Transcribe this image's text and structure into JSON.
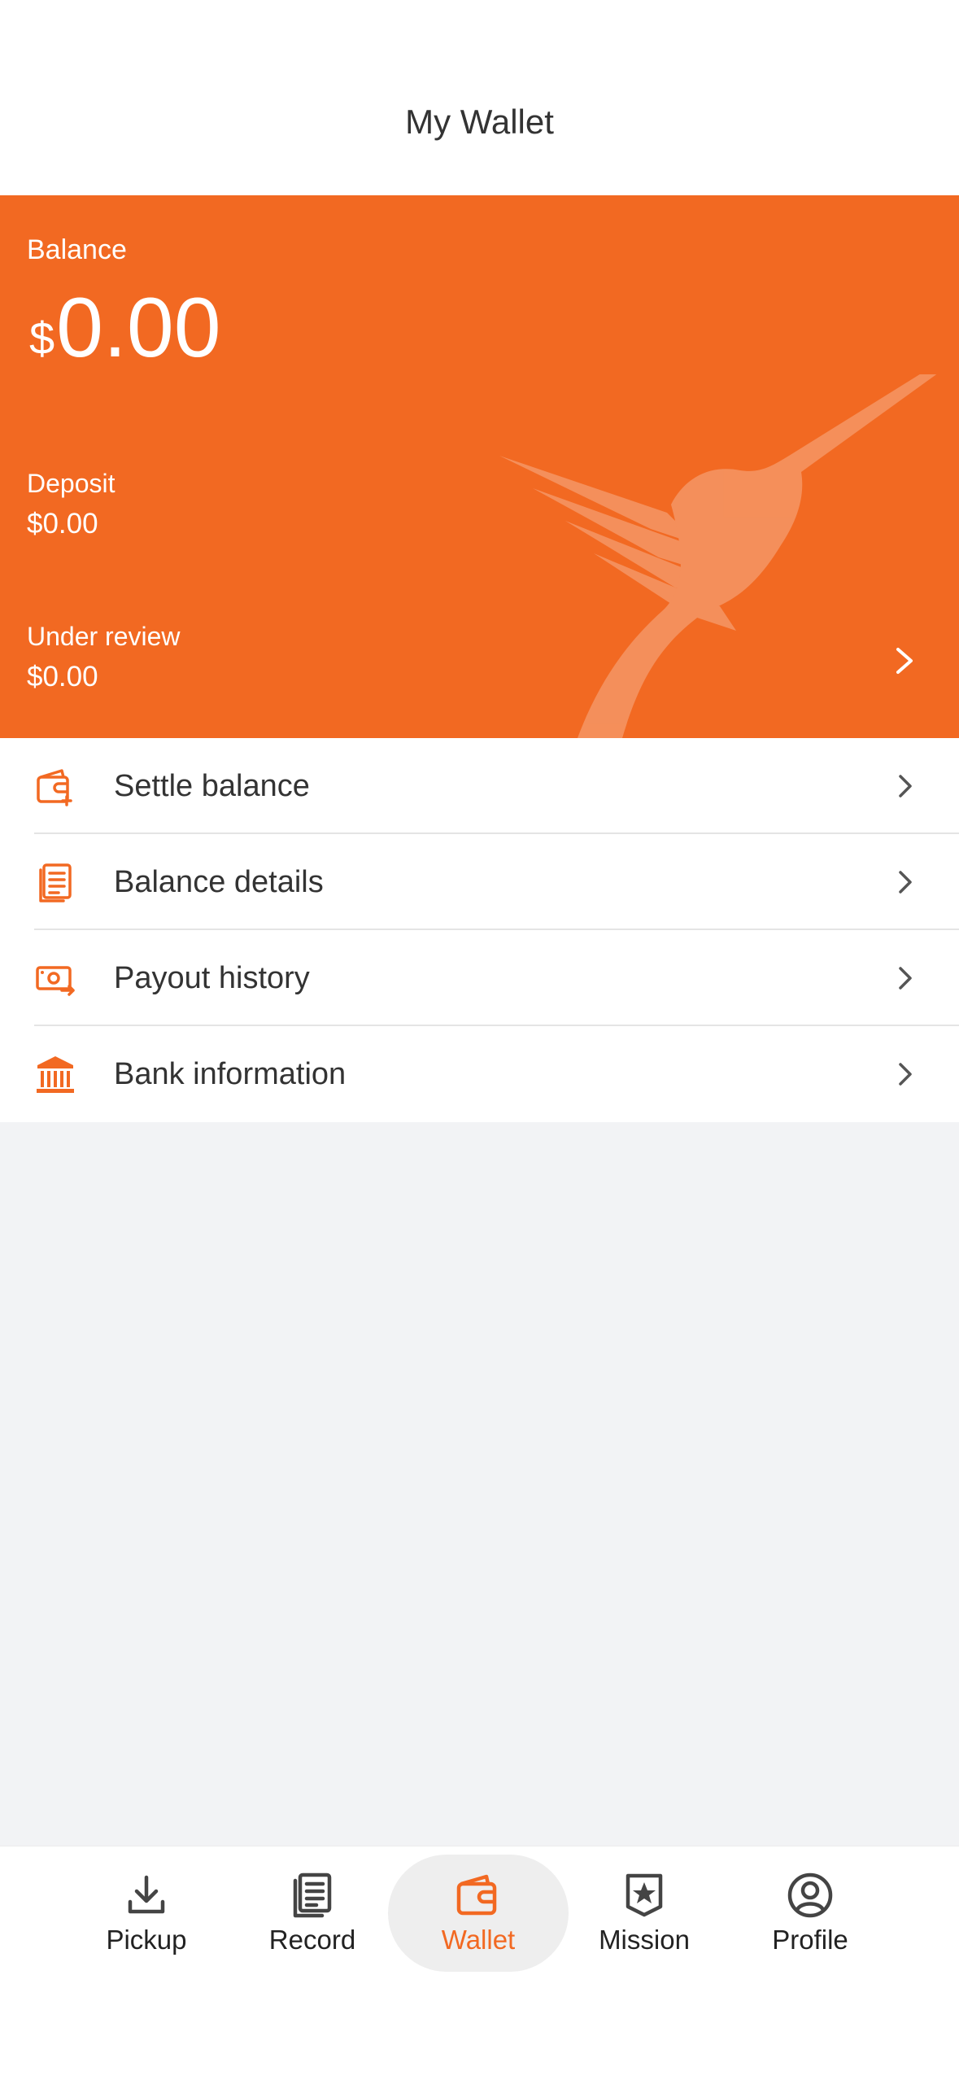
{
  "header": {
    "title": "My Wallet"
  },
  "balance": {
    "label": "Balance",
    "currency": "$",
    "amount": "0.00",
    "deposit_label": "Deposit",
    "deposit_value": "$0.00",
    "under_review_label": "Under review",
    "under_review_value": "$0.00"
  },
  "menu": [
    {
      "label": "Settle balance",
      "icon": "wallet-icon"
    },
    {
      "label": "Balance details",
      "icon": "document-icon"
    },
    {
      "label": "Payout history",
      "icon": "cash-icon"
    },
    {
      "label": "Bank information",
      "icon": "bank-icon"
    }
  ],
  "tabs": [
    {
      "label": "Pickup",
      "icon": "download-icon",
      "active": false
    },
    {
      "label": "Record",
      "icon": "document-icon",
      "active": false
    },
    {
      "label": "Wallet",
      "icon": "wallet-icon",
      "active": true
    },
    {
      "label": "Mission",
      "icon": "star-badge-icon",
      "active": false
    },
    {
      "label": "Profile",
      "icon": "user-circle-icon",
      "active": false
    }
  ],
  "colors": {
    "accent": "#f26922",
    "background": "#f2f3f5"
  }
}
